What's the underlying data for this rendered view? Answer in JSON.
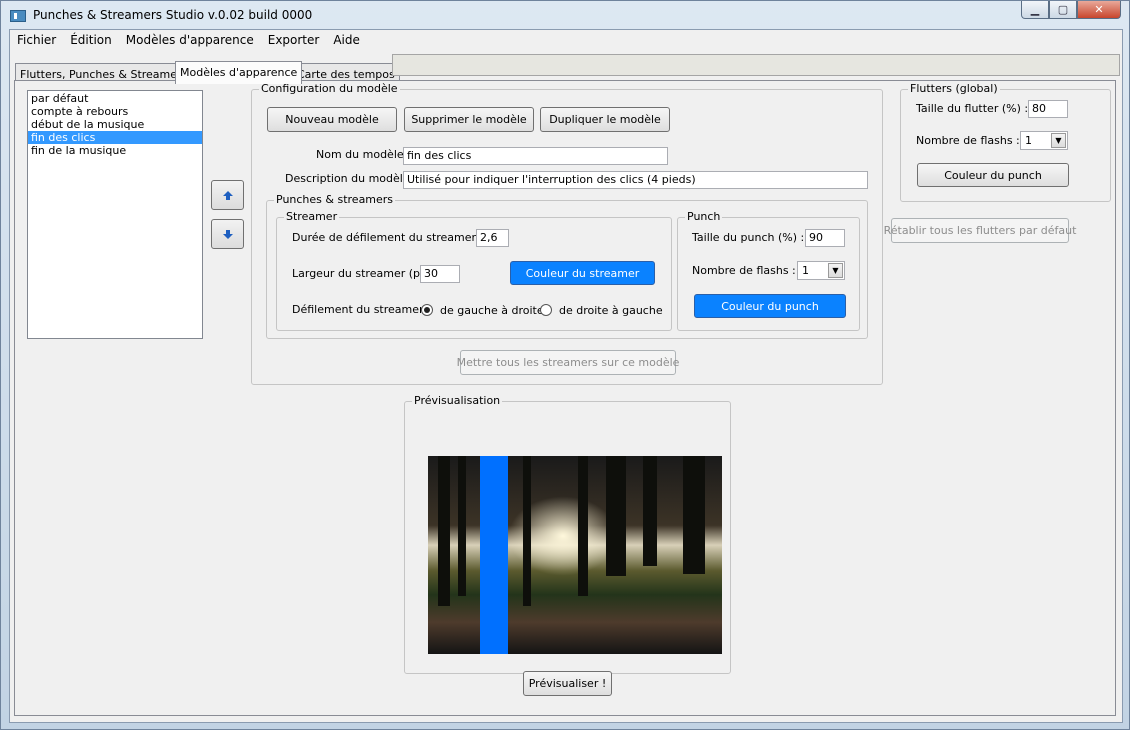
{
  "window": {
    "title": "Punches & Streamers Studio v.0.02 build 0000"
  },
  "menu": [
    "Fichier",
    "Édition",
    "Modèles d'apparence",
    "Exporter",
    "Aide"
  ],
  "tabs": [
    "Flutters, Punches & Streamers",
    "Modèles d'apparence",
    "Carte des tempos"
  ],
  "models_list": [
    "par défaut",
    "compte à rebours",
    "début de la musique",
    "fin des clics",
    "fin de la musique"
  ],
  "model_config": {
    "legend": "Configuration du modèle",
    "new_button": "Nouveau modèle",
    "delete_button": "Supprimer le modèle",
    "duplicate_button": "Dupliquer le modèle",
    "name_label": "Nom du modèle :",
    "name_value": "fin des clics",
    "desc_label": "Description du modèle :",
    "desc_value": "Utilisé pour indiquer l'interruption des clics (4 pieds)",
    "apply_all_button": "Mettre tous les streamers sur ce modèle"
  },
  "punches_streamers": {
    "legend": "Punches & streamers"
  },
  "streamer": {
    "legend": "Streamer",
    "duration_label": "Durée de défilement du streamer (s) :",
    "duration_value": "2,6",
    "width_label": "Largeur du streamer (px) :",
    "width_value": "30",
    "color_button": "Couleur du streamer",
    "direction_label": "Défilement du streamer :",
    "dir_left_right": "de gauche à droite",
    "dir_right_left": "de droite à gauche"
  },
  "punch": {
    "legend": "Punch",
    "size_label": "Taille du punch (%) :",
    "size_value": "90",
    "flashes_label": "Nombre de flashs :",
    "flashes_value": "1",
    "color_button": "Couleur du punch"
  },
  "flutters": {
    "legend": "Flutters (global)",
    "size_label": "Taille du flutter (%) :",
    "size_value": "80",
    "flashes_label": "Nombre de flashs :",
    "flashes_value": "1",
    "color_button": "Couleur du punch",
    "reset_button": "Rétablir tous les flutters par défaut"
  },
  "preview": {
    "legend": "Prévisualisation",
    "button": "Prévisualiser !"
  },
  "colors": {
    "accent_blue": "#0a82ff",
    "selection": "#3399ff"
  }
}
